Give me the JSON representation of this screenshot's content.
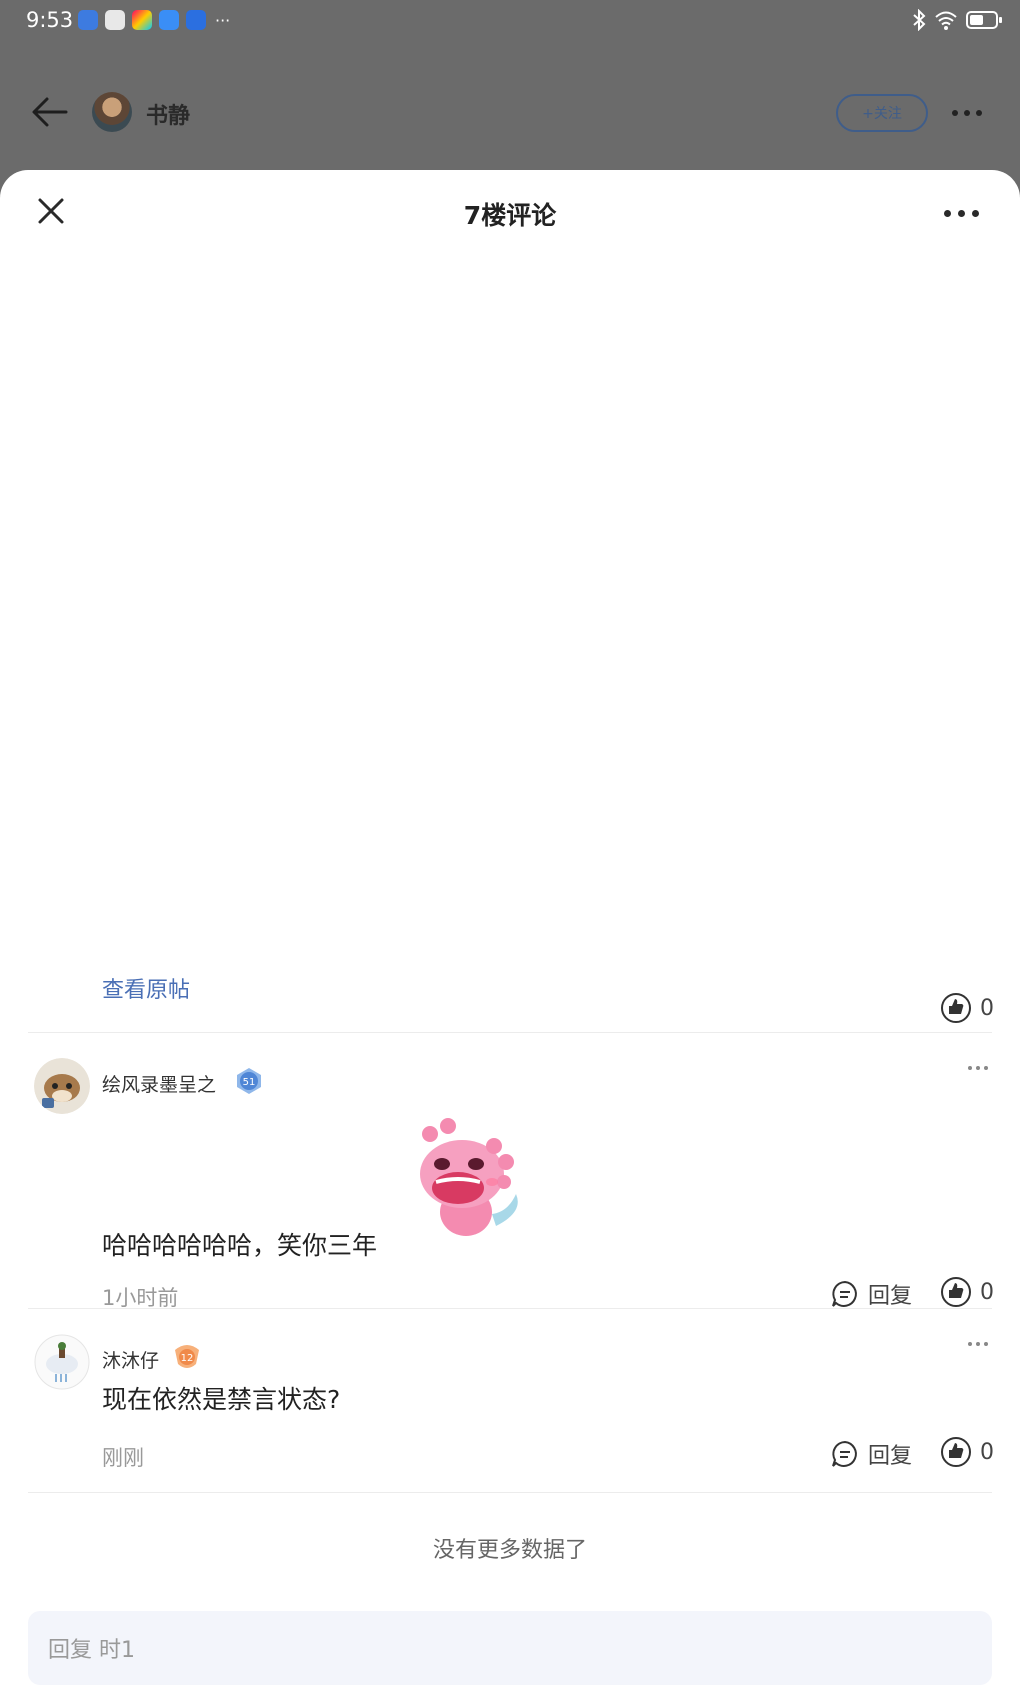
{
  "status_bar": {
    "time": "9:53",
    "dots": "···"
  },
  "background_page": {
    "user_name": "书静",
    "follow_label": "+关注"
  },
  "sheet": {
    "title": "7楼评论",
    "view_original": "查看原帖",
    "post_likes": "0",
    "comments": [
      {
        "user": "绘风录墨呈之",
        "level": "51",
        "text": "哈哈哈哈哈哈，笑你三年",
        "time": "1小时前",
        "reply_label": "回复",
        "likes": "0"
      },
      {
        "user": "沐沐仔",
        "level": "12",
        "text": "现在依然是禁言状态?",
        "time": "刚刚",
        "reply_label": "回复",
        "likes": "0"
      }
    ],
    "no_more": "没有更多数据了",
    "reply_placeholder": "回复 时1"
  },
  "colors": {
    "accent_link": "#4a6fb5",
    "overlay": "#6b6b6b"
  }
}
